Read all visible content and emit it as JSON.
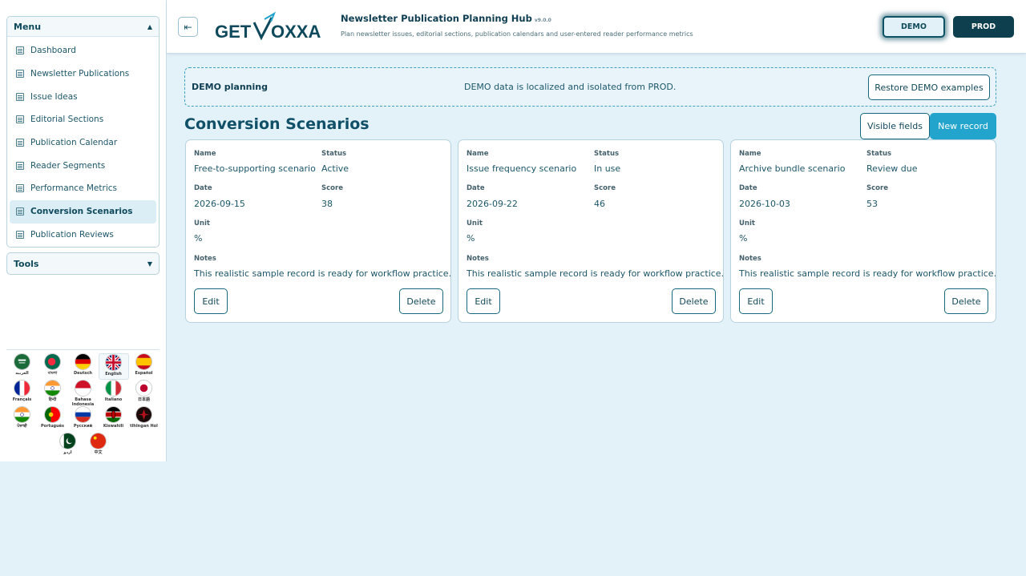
{
  "sidebar": {
    "menu_title": "Menu",
    "items": [
      {
        "label": "Dashboard",
        "active": false
      },
      {
        "label": "Newsletter Publications",
        "active": false
      },
      {
        "label": "Issue Ideas",
        "active": false
      },
      {
        "label": "Editorial Sections",
        "active": false
      },
      {
        "label": "Publication Calendar",
        "active": false
      },
      {
        "label": "Reader Segments",
        "active": false
      },
      {
        "label": "Performance Metrics",
        "active": false
      },
      {
        "label": "Conversion Scenarios",
        "active": true
      },
      {
        "label": "Publication Reviews",
        "active": false
      }
    ],
    "tools_title": "Tools",
    "languages": [
      {
        "label": "العربية",
        "flag": "sa"
      },
      {
        "label": "বাংলা",
        "flag": "bd"
      },
      {
        "label": "Deutsch",
        "flag": "de"
      },
      {
        "label": "English",
        "flag": "gb",
        "selected": true
      },
      {
        "label": "Español",
        "flag": "es"
      },
      {
        "label": "Français",
        "flag": "fr"
      },
      {
        "label": "हिन्दी",
        "flag": "in"
      },
      {
        "label": "Bahasa Indonesia",
        "flag": "id"
      },
      {
        "label": "Italiano",
        "flag": "it"
      },
      {
        "label": "日本語",
        "flag": "jp"
      },
      {
        "label": "ਪੰਜਾਬੀ",
        "flag": "in"
      },
      {
        "label": "Português",
        "flag": "pt"
      },
      {
        "label": "Русский",
        "flag": "ru"
      },
      {
        "label": "Kiswahili",
        "flag": "ke"
      },
      {
        "label": "tlhIngan Hol",
        "flag": "kl"
      },
      {
        "label": "اردو",
        "flag": "pk"
      },
      {
        "label": "中文",
        "flag": "cn"
      }
    ]
  },
  "header": {
    "logo_text_left": "GET",
    "logo_text_right": "OXXA",
    "title": "Newsletter Publication Planning Hub",
    "version": "v9.0.0",
    "subtitle": "Plan newsletter issues, editorial sections, publication calendars and user-entered reader performance metrics",
    "env_demo": "DEMO",
    "env_prod": "PROD"
  },
  "banner": {
    "title": "DEMO planning",
    "message": "DEMO data is localized and isolated from PROD.",
    "restore_label": "Restore DEMO examples"
  },
  "main": {
    "title": "Conversion Scenarios",
    "visible_fields_label": "Visible fields",
    "new_record_label": "New record"
  },
  "field_labels": {
    "name": "Name",
    "status": "Status",
    "date": "Date",
    "score": "Score",
    "unit": "Unit",
    "notes": "Notes",
    "edit": "Edit",
    "delete": "Delete"
  },
  "records": [
    {
      "name": "Free-to-supporting scenario",
      "status": "Active",
      "date": "2026-09-15",
      "score": "38",
      "unit": "%",
      "notes": "This realistic sample record is ready for workflow practice."
    },
    {
      "name": "Issue frequency scenario",
      "status": "In use",
      "date": "2026-09-22",
      "score": "46",
      "unit": "%",
      "notes": "This realistic sample record is ready for workflow practice."
    },
    {
      "name": "Archive bundle scenario",
      "status": "Review due",
      "date": "2026-10-03",
      "score": "53",
      "unit": "%",
      "notes": "This realistic sample record is ready for workflow practice."
    }
  ],
  "colors": {
    "accent": "#23a4cc",
    "dark": "#0e3f4f",
    "background": "#e3f1f8"
  }
}
